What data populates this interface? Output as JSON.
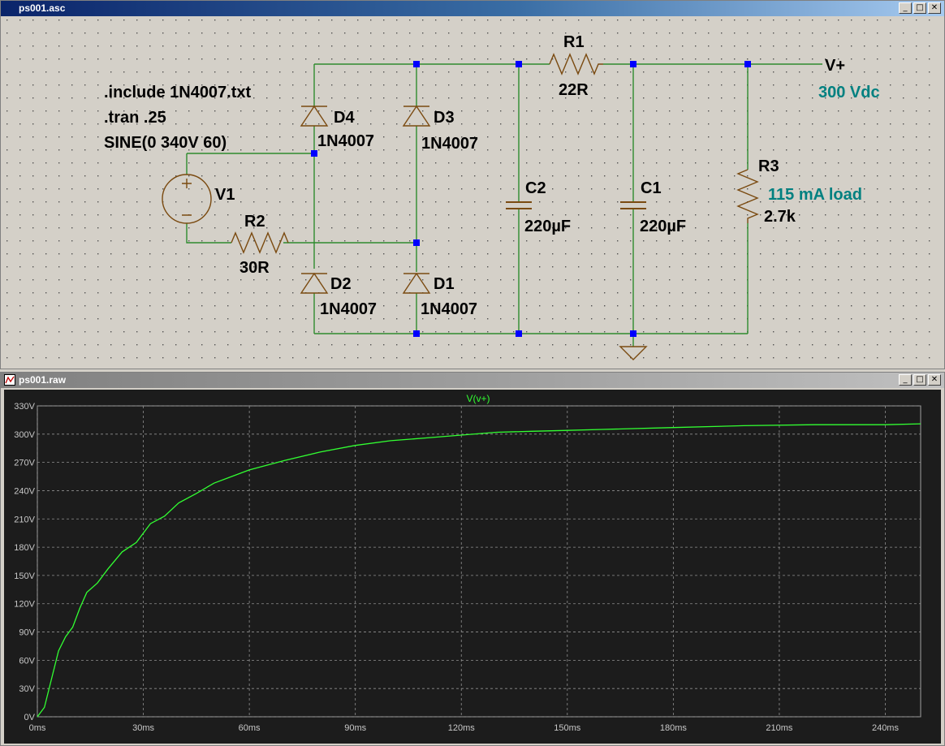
{
  "schematic_window": {
    "title": "ps001.asc",
    "directives": [
      ".include 1N4007.txt",
      ".tran .25",
      "SINE(0 340V 60)"
    ],
    "components": {
      "V1": {
        "name": "V1"
      },
      "R1": {
        "name": "R1",
        "value": "22R"
      },
      "R2": {
        "name": "R2",
        "value": "30R"
      },
      "R3": {
        "name": "R3",
        "value": "2.7k"
      },
      "C1": {
        "name": "C1",
        "value": "220µF"
      },
      "C2": {
        "name": "C2",
        "value": "220µF"
      },
      "D1": {
        "name": "D1",
        "value": "1N4007"
      },
      "D2": {
        "name": "D2",
        "value": "1N4007"
      },
      "D3": {
        "name": "D3",
        "value": "1N4007"
      },
      "D4": {
        "name": "D4",
        "value": "1N4007"
      }
    },
    "net_label": "V+",
    "comments": [
      "300 Vdc",
      "115 mA load"
    ],
    "colors": {
      "background": "#d4d0c8",
      "wire": "#2e8b2e",
      "component": "#7a4a10",
      "node": "#0000ff",
      "comment": "#008080",
      "text": "#000000"
    }
  },
  "waveform_window": {
    "title": "ps001.raw",
    "trace_label": "V(v+)",
    "colors": {
      "background": "#1c1c1c",
      "trace": "#32ff32",
      "axis_text": "#c8c8c8",
      "grid": "#909090"
    }
  },
  "chart_data": {
    "type": "line",
    "title": "",
    "xlabel": "",
    "ylabel": "",
    "xlim": [
      0,
      250
    ],
    "ylim": [
      0,
      330
    ],
    "x_ticks": [
      "0ms",
      "30ms",
      "60ms",
      "90ms",
      "120ms",
      "150ms",
      "180ms",
      "210ms",
      "240ms"
    ],
    "y_ticks": [
      "0V",
      "30V",
      "60V",
      "90V",
      "120V",
      "150V",
      "180V",
      "210V",
      "240V",
      "270V",
      "300V",
      "330V"
    ],
    "grid": true,
    "legend": "top-center",
    "series": [
      {
        "name": "V(v+)",
        "x": [
          0,
          2,
          4,
          6,
          8,
          10,
          12,
          14,
          17,
          20,
          24,
          28,
          32,
          36,
          40,
          45,
          50,
          55,
          60,
          70,
          80,
          90,
          100,
          110,
          120,
          130,
          140,
          150,
          160,
          180,
          200,
          220,
          240,
          250
        ],
        "y": [
          0,
          10,
          40,
          70,
          85,
          95,
          115,
          132,
          142,
          157,
          175,
          185,
          205,
          213,
          227,
          237,
          248,
          255,
          262,
          272,
          281,
          288,
          293,
          296,
          299,
          302,
          303,
          304,
          305,
          307,
          309,
          310,
          310,
          311
        ]
      }
    ]
  }
}
